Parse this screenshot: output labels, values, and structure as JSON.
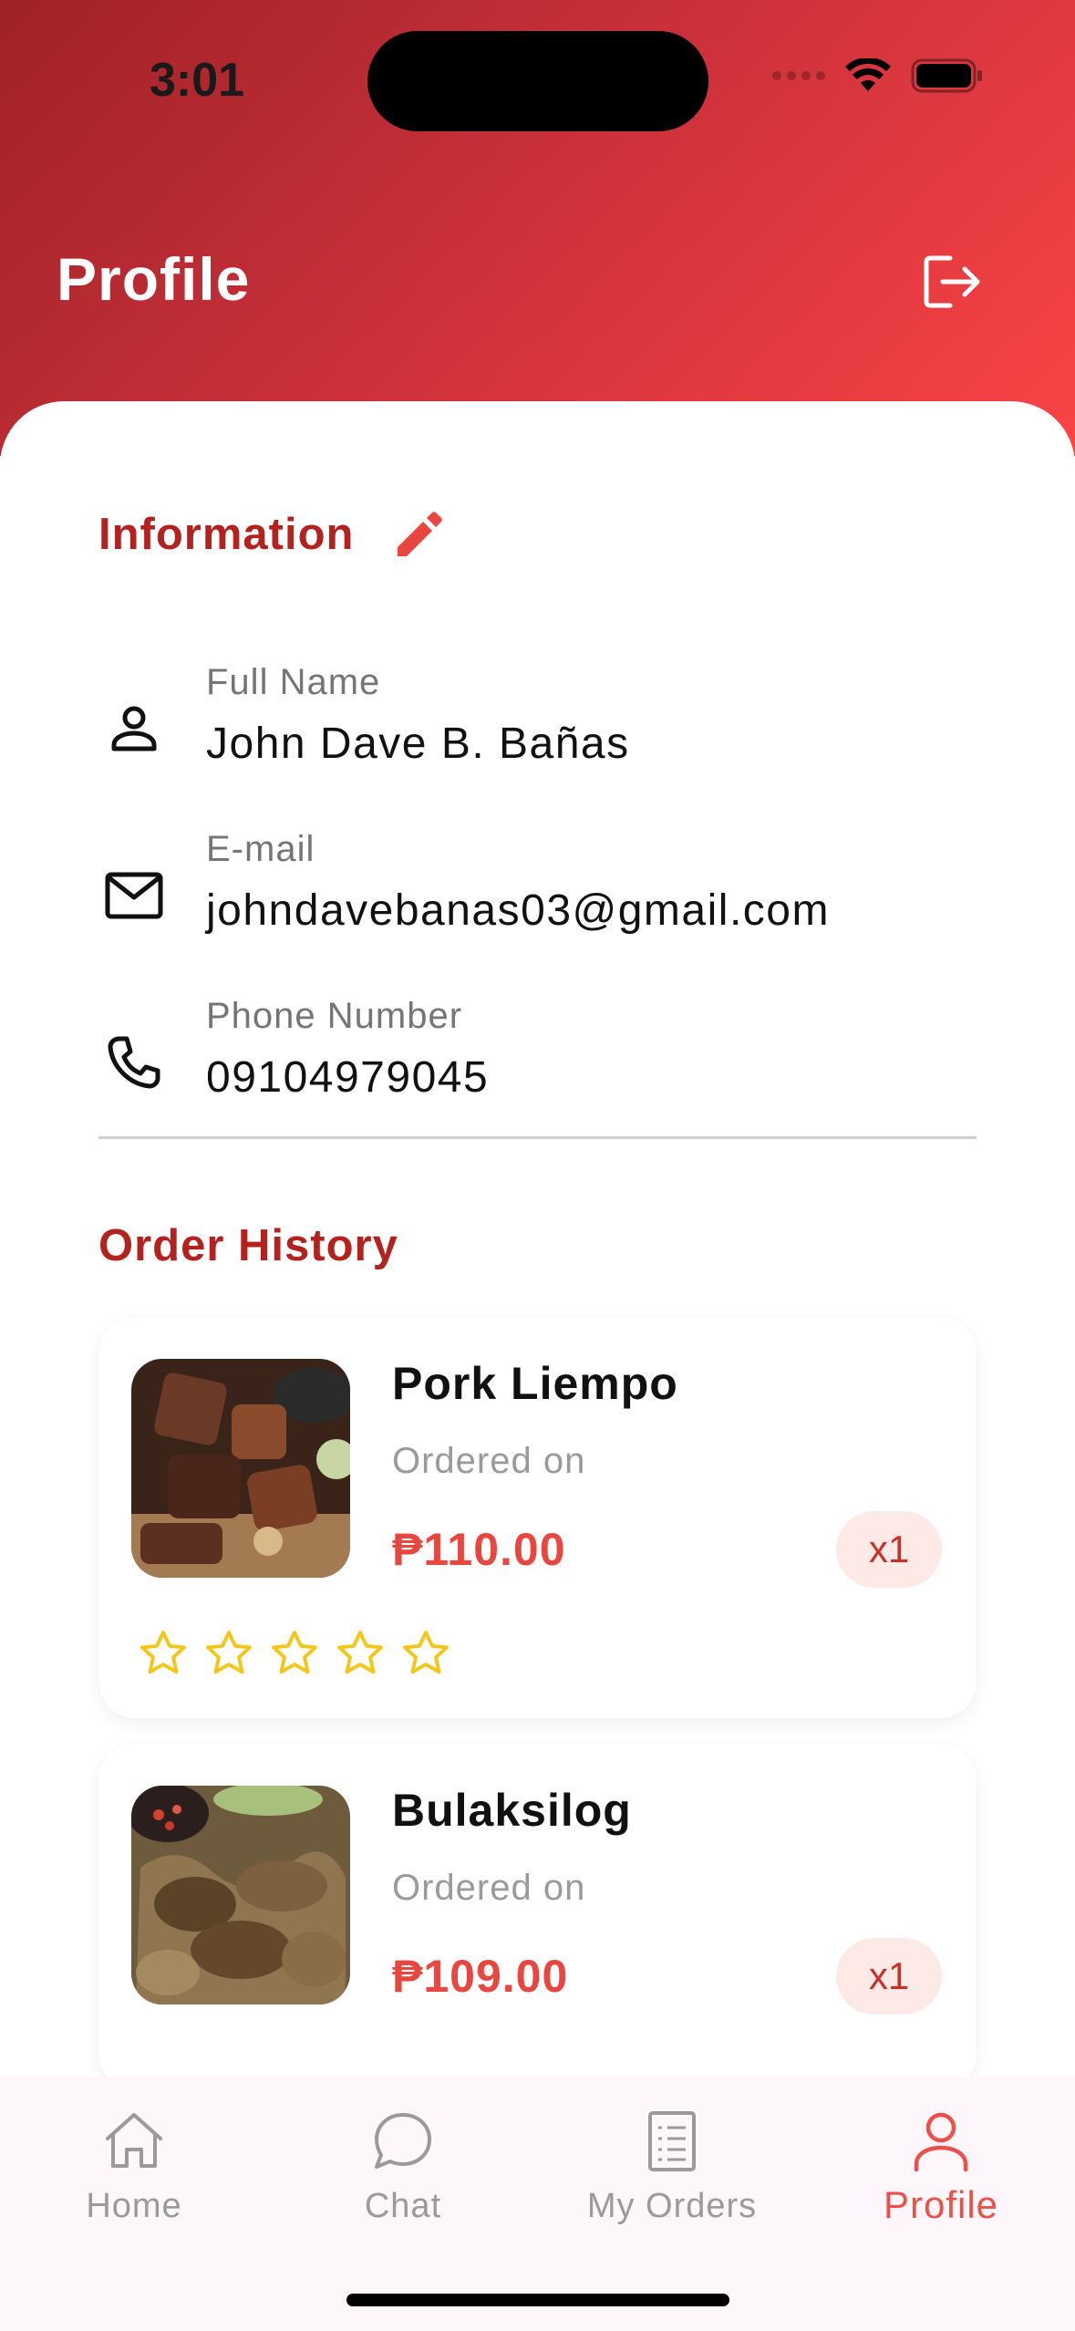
{
  "status_bar": {
    "time": "3:01"
  },
  "header": {
    "title": "Profile"
  },
  "information": {
    "title": "Information",
    "fields": [
      {
        "label": "Full Name",
        "value": "John Dave B. Bañas",
        "icon": "person-icon"
      },
      {
        "label": "E-mail",
        "value": "johndavebanas03@gmail.com",
        "icon": "mail-icon"
      },
      {
        "label": "Phone Number",
        "value": "09104979045",
        "icon": "phone-icon"
      }
    ]
  },
  "order_history": {
    "title": "Order History",
    "orders": [
      {
        "name": "Pork Liempo",
        "ordered_on": "Ordered on",
        "price": "₱110.00",
        "qty": "x1",
        "rating": 0
      },
      {
        "name": "Bulaksilog",
        "ordered_on": "Ordered on",
        "price": "₱109.00",
        "qty": "x1"
      }
    ]
  },
  "bottom_nav": {
    "items": [
      {
        "label": "Home",
        "icon": "home-icon"
      },
      {
        "label": "Chat",
        "icon": "chat-icon"
      },
      {
        "label": "My Orders",
        "icon": "orders-icon"
      },
      {
        "label": "Profile",
        "icon": "profile-icon",
        "active": true
      }
    ]
  },
  "colors": {
    "header_gradient_start": "#9e2226",
    "header_gradient_end": "#fb4446",
    "accent": "#b3221e",
    "price": "#e8463f",
    "active_nav": "#ea5148",
    "star": "#f5c518"
  }
}
